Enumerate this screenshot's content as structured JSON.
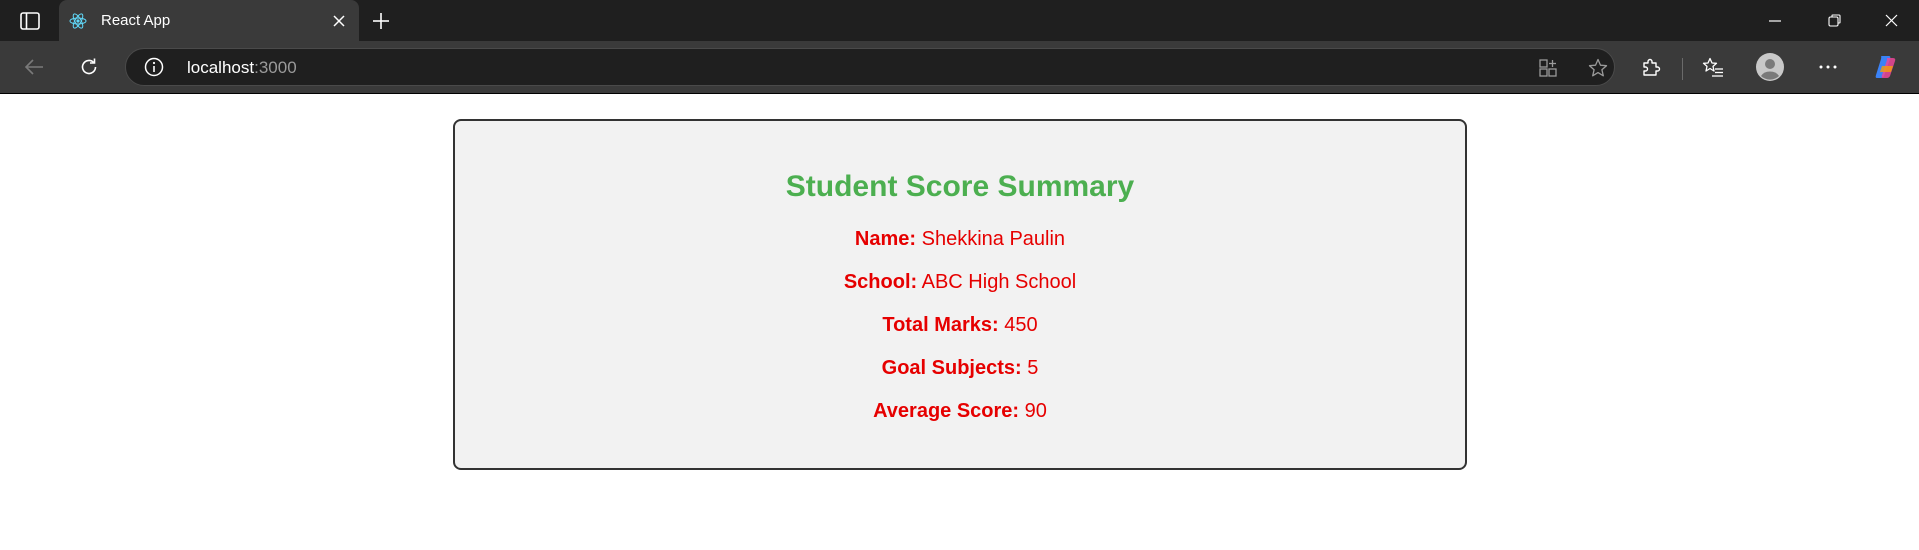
{
  "browser": {
    "tab": {
      "title": "React App"
    },
    "address": {
      "host": "localhost",
      "port": ":3000"
    }
  },
  "summary": {
    "title": "Student Score Summary",
    "rows": [
      {
        "label": "Name:",
        "value": "Shekkina Paulin"
      },
      {
        "label": "School:",
        "value": "ABC High School"
      },
      {
        "label": "Total Marks:",
        "value": "450"
      },
      {
        "label": "Goal Subjects:",
        "value": "5"
      },
      {
        "label": "Average Score:",
        "value": "90"
      }
    ]
  },
  "colors": {
    "title": "#4caf50",
    "text": "#e60000",
    "card_bg": "#f2f2f2",
    "card_border": "#333333"
  },
  "icons": {
    "tab_actions": "tab-actions-icon",
    "favicon": "react-logo-icon",
    "close_tab": "close-icon",
    "new_tab": "plus-icon",
    "back": "arrow-left-icon",
    "refresh": "refresh-icon",
    "site_info": "info-icon",
    "split": "split-screen-icon",
    "favorite": "star-icon",
    "extensions": "puzzle-icon",
    "favorites": "favorites-list-icon",
    "profile": "avatar-icon",
    "more": "more-icon",
    "copilot": "copilot-icon"
  }
}
